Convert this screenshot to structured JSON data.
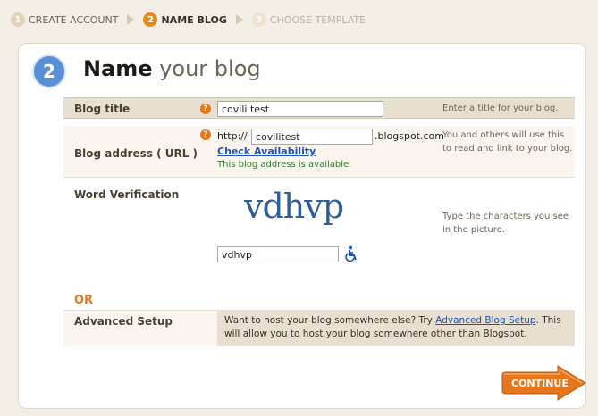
{
  "steps": [
    {
      "num": "1",
      "label": "CREATE ACCOUNT"
    },
    {
      "num": "2",
      "label": "NAME BLOG"
    },
    {
      "num": "3",
      "label": "CHOOSE TEMPLATE"
    }
  ],
  "header": {
    "step_number": "2",
    "title_bold": "Name",
    "title_rest": " your blog"
  },
  "blog_title": {
    "label": "Blog title",
    "value": "covili test",
    "hint": "Enter a title for your blog."
  },
  "blog_address": {
    "label": "Blog address ( URL )",
    "prefix": "http://",
    "value": "covilitest",
    "suffix": ".blogspot.com",
    "check_link": "Check Availability",
    "status": "This blog address is available.",
    "hint_line1": "You and others will use this",
    "hint_line2": "to read and link to your blog."
  },
  "word_verification": {
    "label": "Word Verification",
    "captcha_text": "vdhvp",
    "value": "vdhvp",
    "hint_line1": "Type the characters you see",
    "hint_line2": "in the picture.",
    "access_icon": "wheelchair-icon"
  },
  "or_label": "OR",
  "advanced": {
    "label": "Advanced Setup",
    "text_before": "Want to host your blog somewhere else? Try ",
    "link": "Advanced Blog Setup",
    "text_after": ". This will allow you to host your blog somewhere other than Blogspot."
  },
  "continue_label": "CONTINUE",
  "help_icon_glyph": "?",
  "colors": {
    "accent_orange": "#e5761d",
    "step_blue": "#5a8fd6",
    "link_blue": "#1b55b9",
    "success_green": "#2e7a2a"
  }
}
